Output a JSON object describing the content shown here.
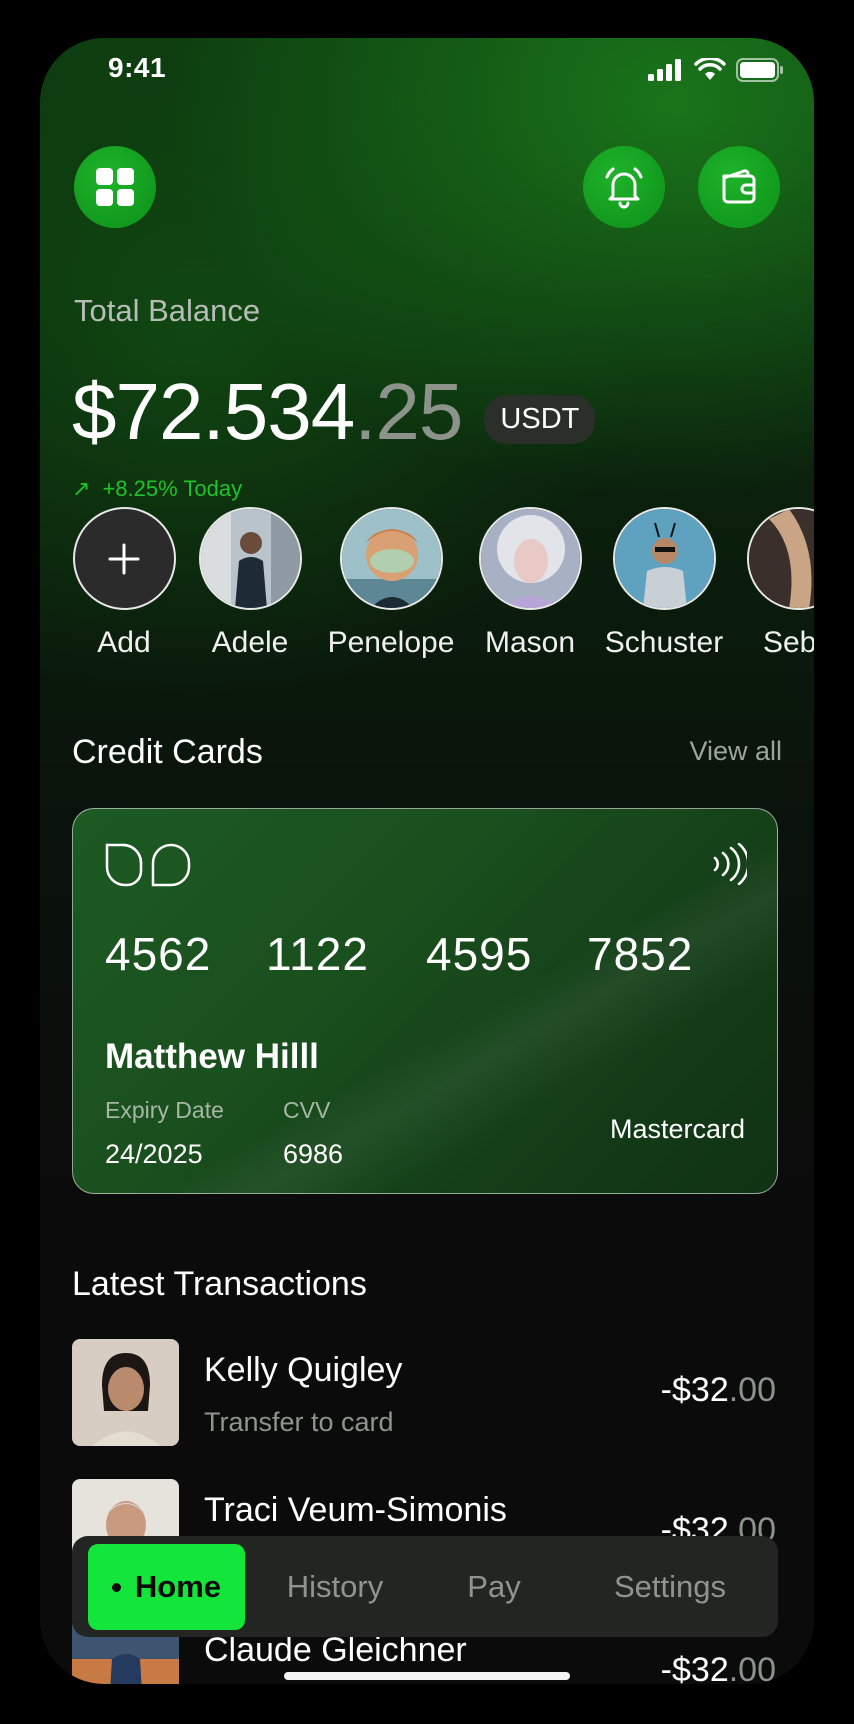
{
  "status_bar": {
    "time": "9:41"
  },
  "header": {
    "menu_icon": "grid-icon",
    "notification_icon": "bell-icon",
    "wallet_icon": "wallet-icon",
    "accent": "#1aa326"
  },
  "balance": {
    "label": "Total Balance",
    "main": "$72.534",
    "cents": ".25",
    "currency": "USDT",
    "change_arrow": "↗",
    "change": "+8.25% Today",
    "change_color": "#22c12c"
  },
  "contacts": [
    {
      "name": "Add",
      "type": "add"
    },
    {
      "name": "Adele"
    },
    {
      "name": "Penelope"
    },
    {
      "name": "Mason"
    },
    {
      "name": "Schuster"
    },
    {
      "name": "Seba"
    }
  ],
  "credit_cards": {
    "title": "Credit Cards",
    "view_all": "View all",
    "card": {
      "number_groups": [
        "4562",
        "1122",
        "4595",
        "7852"
      ],
      "holder": "Matthew Hilll",
      "expiry_label": "Expiry Date",
      "expiry": "24/2025",
      "cvv_label": "CVV",
      "cvv": "6986",
      "brand": "Mastercard"
    }
  },
  "transactions": {
    "title": "Latest Transactions",
    "items": [
      {
        "name": "Kelly Quigley",
        "subtitle": "Transfer to card",
        "amount_main": "-$32",
        "amount_dec": ".00"
      },
      {
        "name": "Traci Veum-Simonis",
        "subtitle": "",
        "amount_main": "-$32",
        "amount_dec": ".00"
      },
      {
        "name": "Claude Gleichner",
        "subtitle": "",
        "amount_main": "-$32",
        "amount_dec": ".00"
      }
    ]
  },
  "tabbar": {
    "active_color": "#13e53a",
    "tabs": [
      {
        "label": "Home",
        "active": true
      },
      {
        "label": "History"
      },
      {
        "label": "Pay"
      },
      {
        "label": "Settings"
      }
    ]
  }
}
